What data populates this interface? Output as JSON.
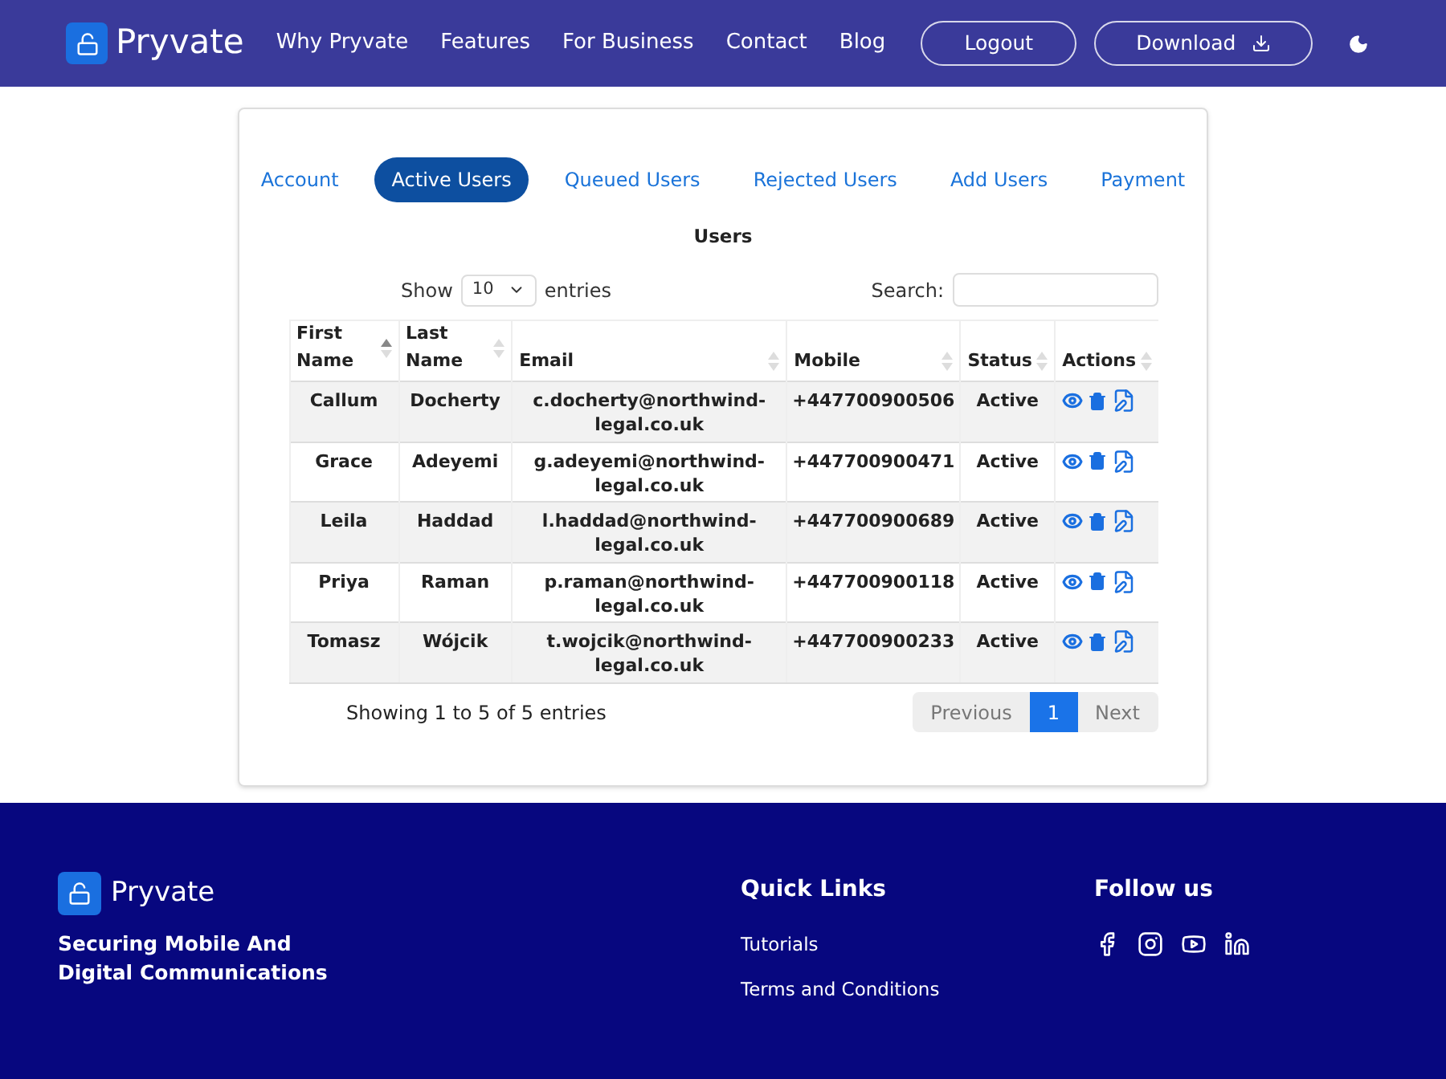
{
  "header": {
    "brand": "Pryvate",
    "nav": [
      "Why Pryvate",
      "Features",
      "For Business",
      "Contact",
      "Blog"
    ],
    "buttons": [
      {
        "label": "Logout",
        "kind": "plain"
      },
      {
        "label": "Download",
        "kind": "download"
      }
    ]
  },
  "tabs": [
    {
      "label": "Account",
      "selected": false
    },
    {
      "label": "Active Users",
      "selected": true
    },
    {
      "label": "Queued Users",
      "selected": false
    },
    {
      "label": "Rejected Users",
      "selected": false
    },
    {
      "label": "Add Users",
      "selected": false
    },
    {
      "label": "Payment",
      "selected": false
    }
  ],
  "title": "Users",
  "length": {
    "before": "Show",
    "value": "10",
    "after": "entries"
  },
  "search": {
    "label": "Search:"
  },
  "table": {
    "columns": [
      {
        "label": "First Name",
        "sorted": true
      },
      {
        "label": "Last Name",
        "sorted": false
      },
      {
        "label": "Email",
        "sorted": false
      },
      {
        "label": "Mobile",
        "sorted": false
      },
      {
        "label": "Status",
        "sorted": false
      },
      {
        "label": "Actions",
        "sorted": false
      }
    ],
    "rows": [
      [
        "Callum",
        "Docherty",
        "c.docherty@northwind-legal.co.uk",
        "+447700900506",
        "Active"
      ],
      [
        "Grace",
        "Adeyemi",
        "g.adeyemi@northwind-legal.co.uk",
        "+447700900471",
        "Active"
      ],
      [
        "Leila",
        "Haddad",
        "l.haddad@northwind-legal.co.uk",
        "+447700900689",
        "Active"
      ],
      [
        "Priya",
        "Raman",
        "p.raman@northwind-legal.co.uk",
        "+447700900118",
        "Active"
      ],
      [
        "Tomasz",
        "Wójcik",
        "t.wojcik@northwind-legal.co.uk",
        "+447700900233",
        "Active"
      ]
    ]
  },
  "info": "Showing 1 to 5 of 5 entries",
  "pagination": [
    {
      "label": "Previous",
      "selected": false
    },
    {
      "label": "1",
      "selected": true
    },
    {
      "label": "Next",
      "selected": false
    }
  ],
  "footer": {
    "brand": "Pryvate",
    "tagline": [
      "Securing Mobile And",
      "Digital Communications"
    ],
    "quick_links_title": "Quick Links",
    "quick_links": [
      "Tutorials",
      "Terms and Conditions"
    ],
    "follow_title": "Follow us"
  }
}
